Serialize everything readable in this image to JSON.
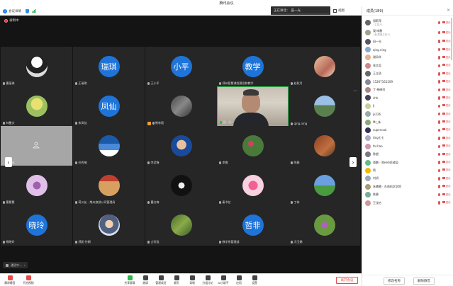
{
  "window": {
    "title": "腾讯会议"
  },
  "toolbar": {
    "info_label": "会议详情",
    "speaking_label": "正在讲话：",
    "speaking_name": "田一光",
    "view_label": "视图"
  },
  "recording": {
    "label": "录制中"
  },
  "tiles": [
    {
      "name": "曹丽珠",
      "avatar_text": "",
      "color": "#e8e8e8",
      "pic": "bw"
    },
    {
      "name": "王瑞琪",
      "avatar_text": "瑞琪",
      "color": "#1e74d9"
    },
    {
      "name": "王小平",
      "avatar_text": "小平",
      "color": "#1e74d9"
    },
    {
      "name": "郑州智慧课程建设和教学",
      "avatar_text": "教学",
      "color": "#1e74d9"
    },
    {
      "name": "赵秋月",
      "avatar_text": "",
      "color": "#d9b0a0",
      "pic": "people"
    },
    {
      "name": "林曼文",
      "avatar_text": "",
      "color": "#d6e0a0",
      "pic": "teletubby"
    },
    {
      "name": "宋凤仙",
      "avatar_text": "凤仙",
      "color": "#1e74d9"
    },
    {
      "name": "熊林丽",
      "avatar_text": "",
      "color": "#555",
      "pic": "dark"
    },
    {
      "name": "田一光",
      "avatar_text": "",
      "active": true
    },
    {
      "name": "qing.ning",
      "avatar_text": "",
      "color": "#7aa0c8",
      "pic": "building"
    },
    {
      "name": "王立琰",
      "avatar_text": "",
      "gray": true
    },
    {
      "name": "任秀楠",
      "avatar_text": "",
      "color": "#3a78c8",
      "pic": "bridge"
    },
    {
      "name": "李武锋",
      "avatar_text": "",
      "color": "#2a5db0",
      "pic": "man"
    },
    {
      "name": "李霞",
      "avatar_text": "",
      "color": "#5a7a4a",
      "pic": "flowers"
    },
    {
      "name": "陈静",
      "avatar_text": "",
      "color": "#a05030",
      "pic": "horse"
    },
    {
      "name": "曹慧慧",
      "avatar_text": "",
      "color": "#c0a0d0",
      "pic": "flower"
    },
    {
      "name": "蒋川友 · 荆州旅游公司管理局",
      "avatar_text": "",
      "color": "#b87a4a",
      "pic": "room"
    },
    {
      "name": "曹红梅",
      "avatar_text": "",
      "color": "#222",
      "pic": "watch"
    },
    {
      "name": "秦书艺",
      "avatar_text": "",
      "color": "#d890b0",
      "pic": "roses"
    },
    {
      "name": "丁林",
      "avatar_text": "",
      "color": "#4a90d0",
      "pic": "field"
    },
    {
      "name": "杨晓玲",
      "avatar_text": "晓玲",
      "color": "#1e74d9"
    },
    {
      "name": "郑凯·孙娟",
      "avatar_text": "",
      "color": "#c8d0e0",
      "pic": "girl"
    },
    {
      "name": "占玲珑",
      "avatar_text": "",
      "color": "#6a8a4a",
      "pic": "garden"
    },
    {
      "name": "教学系管理部",
      "avatar_text": "哲非",
      "color": "#1e74d9"
    },
    {
      "name": "冯玉娟",
      "avatar_text": "",
      "color": "#8ab060",
      "pic": "purple"
    }
  ],
  "mini_status": {
    "label": "通话中..."
  },
  "bottombar": {
    "items": [
      {
        "label": "解除静音"
      },
      {
        "label": "开启视频"
      },
      {
        "label": "共享屏幕"
      },
      {
        "label": "邀请"
      },
      {
        "label": "管理成员"
      },
      {
        "label": "聊天"
      },
      {
        "label": "录制"
      },
      {
        "label": "分组讨论"
      },
      {
        "label": "AI小助手"
      },
      {
        "label": "应用"
      },
      {
        "label": "设置"
      }
    ],
    "leave_label": "离开会议"
  },
  "sidebar": {
    "title": "成员(189)",
    "members": [
      {
        "name": "郑莉萍",
        "role": "(主持人)",
        "color": "#666"
      },
      {
        "name": "我/李鹏",
        "role": "(我,联席主持人)",
        "color": "#a0a090"
      },
      {
        "name": "田一光",
        "role": "",
        "color": "#556"
      },
      {
        "name": "qing.ning",
        "role": "",
        "color": "#8ac"
      },
      {
        "name": "谢凤华",
        "role": "",
        "color": "#e8b08a"
      },
      {
        "name": "张文蕊",
        "role": "",
        "color": "#c88"
      },
      {
        "name": "王立琰",
        "role": "",
        "color": "#666"
      },
      {
        "name": "15267161209",
        "role": "",
        "color": "#889"
      },
      {
        "name": "丁-杨晓玲",
        "role": "",
        "color": "#a88"
      },
      {
        "name": "chh",
        "role": "",
        "color": "#445"
      },
      {
        "name": "lJ",
        "role": "",
        "color": "#cc9"
      },
      {
        "name": "jk226",
        "role": "",
        "color": "#9aa"
      },
      {
        "name": "Mr_朱",
        "role": "",
        "color": "#8a7"
      },
      {
        "name": "supercool",
        "role": "",
        "color": "#335"
      },
      {
        "name": "ting七七",
        "role": "",
        "color": "#aac"
      },
      {
        "name": "fol.hao",
        "role": "",
        "color": "#c9a"
      },
      {
        "name": "陈超",
        "role": "",
        "color": "#778"
      },
      {
        "name": "咸鹏 · 郑州市民政局",
        "role": "",
        "color": "#6b8"
      },
      {
        "name": "简",
        "role": "",
        "color": "#eb0"
      },
      {
        "name": "刘妍",
        "role": "",
        "color": "#9ab"
      },
      {
        "name": "朱曦曦 · 东南科学学院",
        "role": "",
        "color": "#a97"
      },
      {
        "name": "陈静",
        "role": "",
        "color": "#7a9"
      },
      {
        "name": "王佳怡",
        "role": "",
        "color": "#c99"
      }
    ],
    "cam_label": "图片",
    "edit_name_label": "修改名称",
    "unmute_all_label": "解除静音"
  }
}
